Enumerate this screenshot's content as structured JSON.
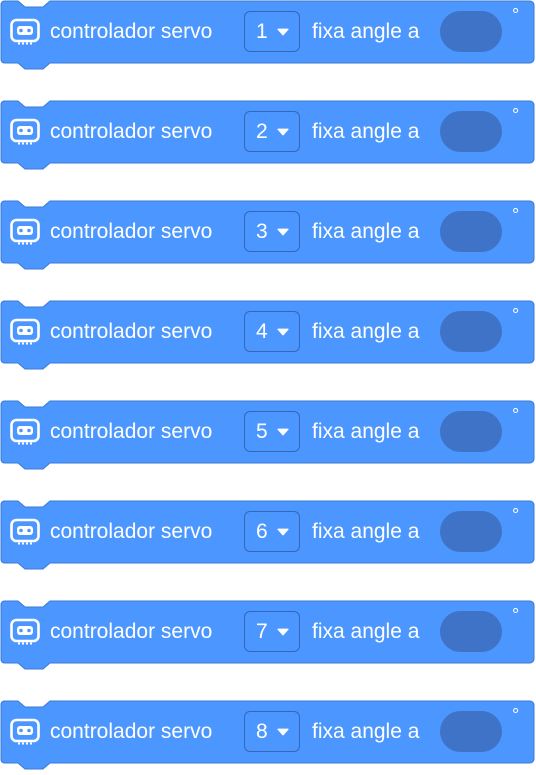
{
  "colors": {
    "block_fill": "#4c97ff",
    "block_border": "#3b78d3",
    "input_fill": "#3f73c8",
    "text": "#ffffff"
  },
  "block_icon": "microbit-board-icon",
  "blocks": [
    {
      "label_before": "controlador servo",
      "servo_number": "1",
      "label_after": "fixa angle a",
      "angle_value": "",
      "unit": "°"
    },
    {
      "label_before": "controlador servo",
      "servo_number": "2",
      "label_after": "fixa angle a",
      "angle_value": "",
      "unit": "°"
    },
    {
      "label_before": "controlador servo",
      "servo_number": "3",
      "label_after": "fixa angle a",
      "angle_value": "",
      "unit": "°"
    },
    {
      "label_before": "controlador servo",
      "servo_number": "4",
      "label_after": "fixa angle a",
      "angle_value": "",
      "unit": "°"
    },
    {
      "label_before": "controlador servo",
      "servo_number": "5",
      "label_after": "fixa angle a",
      "angle_value": "",
      "unit": "°"
    },
    {
      "label_before": "controlador servo",
      "servo_number": "6",
      "label_after": "fixa angle a",
      "angle_value": "",
      "unit": "°"
    },
    {
      "label_before": "controlador servo",
      "servo_number": "7",
      "label_after": "fixa angle a",
      "angle_value": "",
      "unit": "°"
    },
    {
      "label_before": "controlador servo",
      "servo_number": "8",
      "label_after": "fixa angle a",
      "angle_value": "",
      "unit": "°"
    }
  ]
}
